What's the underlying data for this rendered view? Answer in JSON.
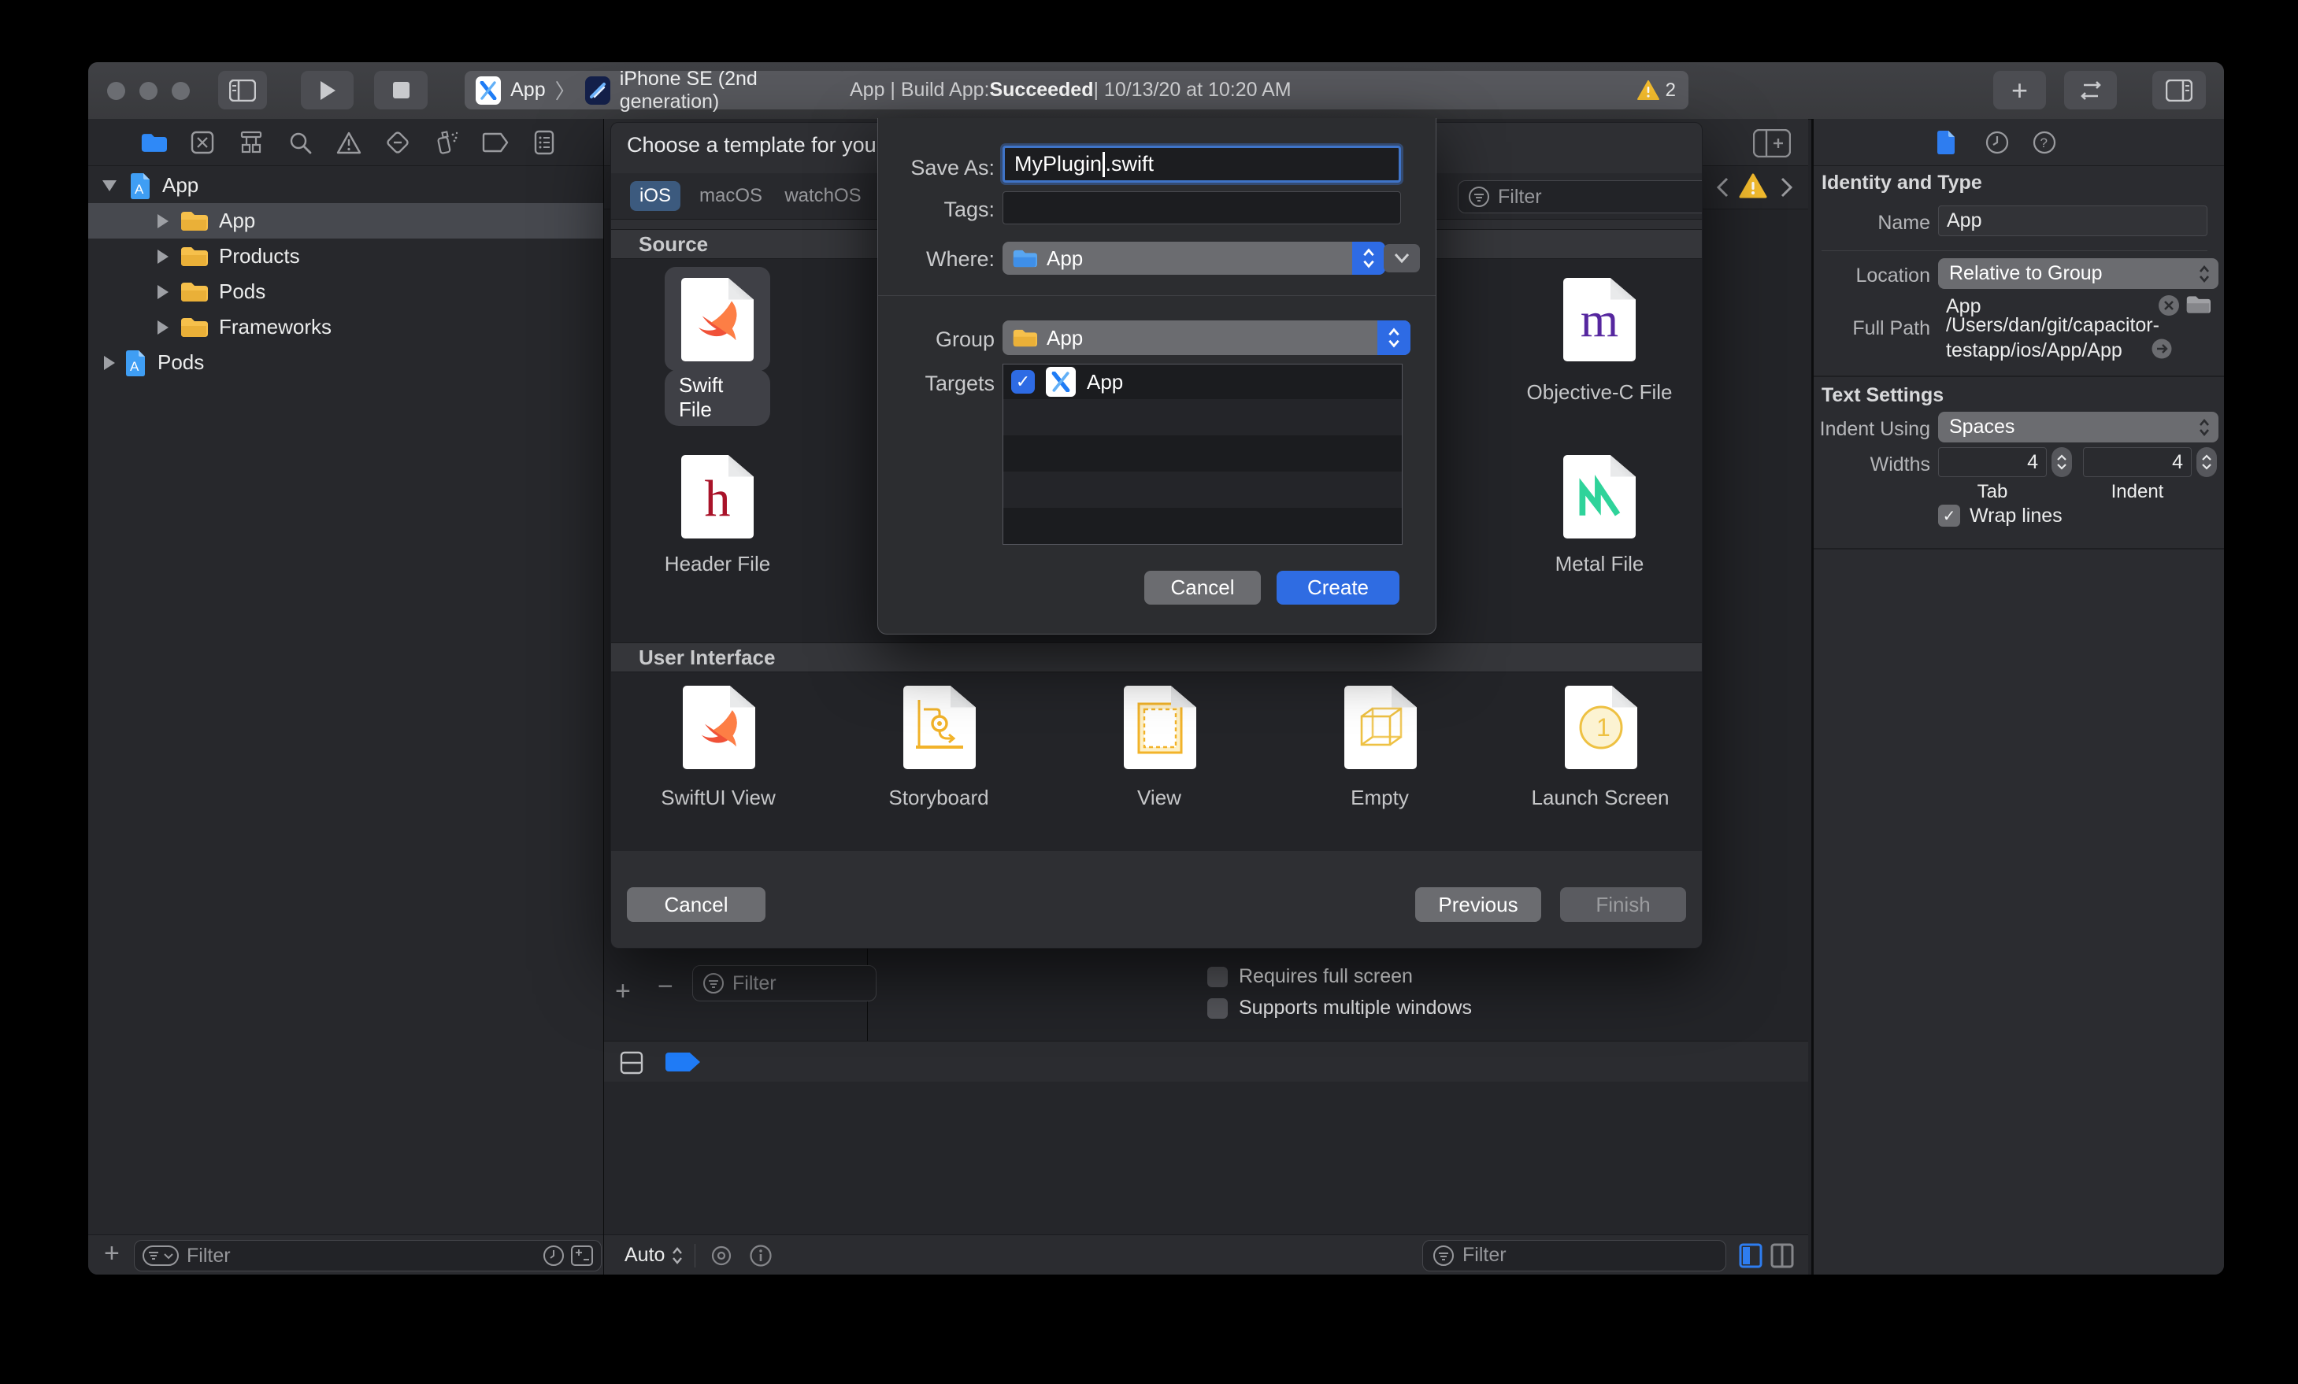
{
  "titlebar": {
    "scheme_app": "App",
    "scheme_device": "iPhone SE (2nd generation)",
    "status_prefix": "App | Build App: ",
    "status_result": "Succeeded",
    "status_suffix": " | 10/13/20 at 10:20 AM",
    "warning_count": "2"
  },
  "navigator": {
    "items": [
      {
        "label": "App"
      },
      {
        "label": "App"
      },
      {
        "label": "Products"
      },
      {
        "label": "Pods"
      },
      {
        "label": "Frameworks"
      },
      {
        "label": "Pods"
      }
    ]
  },
  "filters": {
    "placeholder": "Filter"
  },
  "dialog": {
    "title": "Choose a template for your",
    "tabs": {
      "ios": "iOS",
      "macos": "macOS",
      "watchos": "watchOS"
    },
    "source_label": "Source",
    "ui_label": "User Interface",
    "templates": {
      "swift_file": "Swift File",
      "header_file": "Header File",
      "objc_file": "Objective-C File",
      "metal_file": "Metal File",
      "swiftui_view": "SwiftUI View",
      "storyboard": "Storyboard",
      "view": "View",
      "empty": "Empty",
      "launch_screen": "Launch Screen"
    },
    "cancel": "Cancel",
    "previous": "Previous",
    "finish": "Finish"
  },
  "sheet": {
    "save_as_label": "Save As:",
    "save_as_name": "MyPlugin",
    "save_as_ext": ".swift",
    "tags_label": "Tags:",
    "where_label": "Where:",
    "where_value": "App",
    "group_label": "Group",
    "group_value": "App",
    "targets_label": "Targets",
    "target_name": "App",
    "cancel": "Cancel",
    "create": "Create"
  },
  "inspector": {
    "identity_header": "Identity and Type",
    "name_label": "Name",
    "name_value": "App",
    "location_label": "Location",
    "location_value": "Relative to Group",
    "group_value": "App",
    "full_path_label": "Full Path",
    "full_path_line1": "/Users/dan/git/capacitor-",
    "full_path_line2": "testapp/ios/App/App",
    "text_settings_header": "Text Settings",
    "indent_using_label": "Indent Using",
    "indent_using_value": "Spaces",
    "widths_label": "Widths",
    "tab_width": "4",
    "indent_width": "4",
    "tab_caption": "Tab",
    "indent_caption": "Indent",
    "wrap_lines_label": "Wrap lines"
  },
  "bottom": {
    "requires_full_screen": "Requires full screen",
    "supports_multiple_windows": "Supports multiple windows",
    "auto_label": "Auto"
  },
  "colors": {
    "accent": "#2e6be4",
    "warning": "#f5bd2e",
    "selected_tab": "#3c5a7e"
  }
}
